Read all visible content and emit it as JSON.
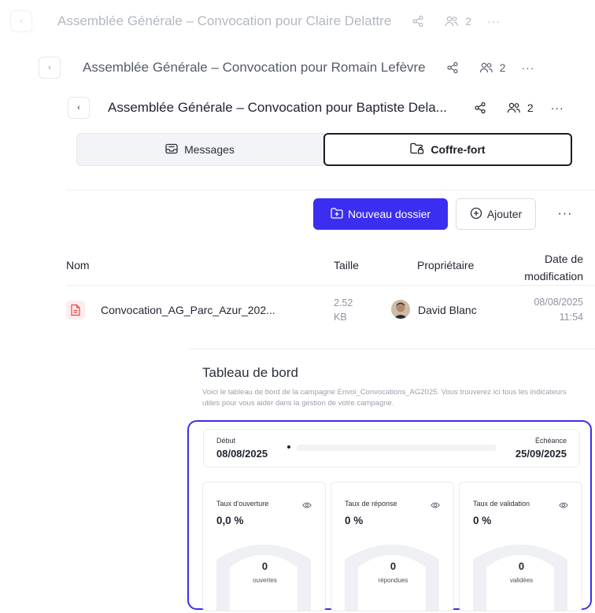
{
  "headers": [
    {
      "title": "Assemblée Générale – Convocation pour Claire Delattre",
      "members": "2"
    },
    {
      "title": "Assemblée Générale – Convocation pour Romain Lefèvre",
      "members": "2"
    },
    {
      "title": "Assemblée Générale – Convocation pour Baptiste Dela...",
      "members": "2"
    }
  ],
  "tabs": [
    {
      "label": "Messages",
      "icon": "inbox-icon",
      "active": false
    },
    {
      "label": "Coffre-fort",
      "icon": "folder-lock-icon",
      "active": true
    }
  ],
  "toolbar": {
    "new_folder_label": "Nouveau dossier",
    "add_label": "Ajouter",
    "more_label": "···"
  },
  "table": {
    "columns": {
      "name": "Nom",
      "size": "Taille",
      "owner": "Propriétaire",
      "modified_line1": "Date de",
      "modified_line2": "modification"
    },
    "rows": [
      {
        "name": "Convocation_AG_Parc_Azur_202...",
        "size_value": "2.52",
        "size_unit": "KB",
        "owner": "David Blanc",
        "date": "08/08/2025",
        "time": "11:54"
      }
    ]
  },
  "dashboard": {
    "title": "Tableau de bord",
    "description": "Voici le tableau de bord de la campagne Envoi_Convocations_AG2025. Vous trouverez ici tous les indicateurs utiles pour vous aider dans la gestion de votre campagne.",
    "timeline": {
      "start_label": "Début",
      "start_date": "08/08/2025",
      "end_label": "Échéance",
      "end_date": "25/09/2025",
      "progress": 0
    },
    "cards": [
      {
        "label": "Taux d'ouverture",
        "value": "0,0 %",
        "count": "0",
        "caption": "ouvertes"
      },
      {
        "label": "Taux de réponse",
        "value": "0 %",
        "count": "0",
        "caption": "répondues"
      },
      {
        "label": "Taux de validation",
        "value": "0 %",
        "count": "0",
        "caption": "validées"
      }
    ]
  },
  "colors": {
    "accent": "#3b2ef0",
    "file_icon": "#e5484d"
  }
}
